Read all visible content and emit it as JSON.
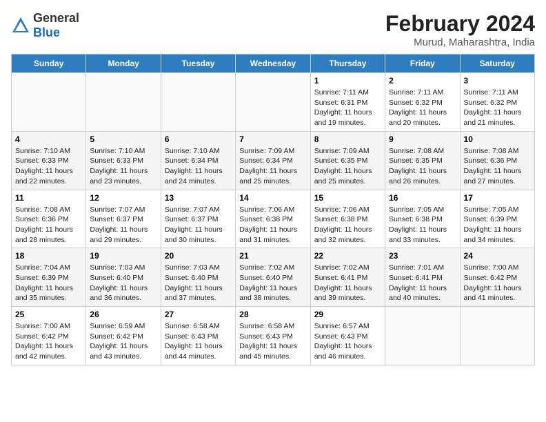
{
  "logo": {
    "text_general": "General",
    "text_blue": "Blue"
  },
  "title": "February 2024",
  "subtitle": "Murud, Maharashtra, India",
  "days_header": [
    "Sunday",
    "Monday",
    "Tuesday",
    "Wednesday",
    "Thursday",
    "Friday",
    "Saturday"
  ],
  "weeks": [
    [
      {
        "day": "",
        "info": ""
      },
      {
        "day": "",
        "info": ""
      },
      {
        "day": "",
        "info": ""
      },
      {
        "day": "",
        "info": ""
      },
      {
        "day": "1",
        "info": "Sunrise: 7:11 AM\nSunset: 6:31 PM\nDaylight: 11 hours\nand 19 minutes."
      },
      {
        "day": "2",
        "info": "Sunrise: 7:11 AM\nSunset: 6:32 PM\nDaylight: 11 hours\nand 20 minutes."
      },
      {
        "day": "3",
        "info": "Sunrise: 7:11 AM\nSunset: 6:32 PM\nDaylight: 11 hours\nand 21 minutes."
      }
    ],
    [
      {
        "day": "4",
        "info": "Sunrise: 7:10 AM\nSunset: 6:33 PM\nDaylight: 11 hours\nand 22 minutes."
      },
      {
        "day": "5",
        "info": "Sunrise: 7:10 AM\nSunset: 6:33 PM\nDaylight: 11 hours\nand 23 minutes."
      },
      {
        "day": "6",
        "info": "Sunrise: 7:10 AM\nSunset: 6:34 PM\nDaylight: 11 hours\nand 24 minutes."
      },
      {
        "day": "7",
        "info": "Sunrise: 7:09 AM\nSunset: 6:34 PM\nDaylight: 11 hours\nand 25 minutes."
      },
      {
        "day": "8",
        "info": "Sunrise: 7:09 AM\nSunset: 6:35 PM\nDaylight: 11 hours\nand 25 minutes."
      },
      {
        "day": "9",
        "info": "Sunrise: 7:08 AM\nSunset: 6:35 PM\nDaylight: 11 hours\nand 26 minutes."
      },
      {
        "day": "10",
        "info": "Sunrise: 7:08 AM\nSunset: 6:36 PM\nDaylight: 11 hours\nand 27 minutes."
      }
    ],
    [
      {
        "day": "11",
        "info": "Sunrise: 7:08 AM\nSunset: 6:36 PM\nDaylight: 11 hours\nand 28 minutes."
      },
      {
        "day": "12",
        "info": "Sunrise: 7:07 AM\nSunset: 6:37 PM\nDaylight: 11 hours\nand 29 minutes."
      },
      {
        "day": "13",
        "info": "Sunrise: 7:07 AM\nSunset: 6:37 PM\nDaylight: 11 hours\nand 30 minutes."
      },
      {
        "day": "14",
        "info": "Sunrise: 7:06 AM\nSunset: 6:38 PM\nDaylight: 11 hours\nand 31 minutes."
      },
      {
        "day": "15",
        "info": "Sunrise: 7:06 AM\nSunset: 6:38 PM\nDaylight: 11 hours\nand 32 minutes."
      },
      {
        "day": "16",
        "info": "Sunrise: 7:05 AM\nSunset: 6:38 PM\nDaylight: 11 hours\nand 33 minutes."
      },
      {
        "day": "17",
        "info": "Sunrise: 7:05 AM\nSunset: 6:39 PM\nDaylight: 11 hours\nand 34 minutes."
      }
    ],
    [
      {
        "day": "18",
        "info": "Sunrise: 7:04 AM\nSunset: 6:39 PM\nDaylight: 11 hours\nand 35 minutes."
      },
      {
        "day": "19",
        "info": "Sunrise: 7:03 AM\nSunset: 6:40 PM\nDaylight: 11 hours\nand 36 minutes."
      },
      {
        "day": "20",
        "info": "Sunrise: 7:03 AM\nSunset: 6:40 PM\nDaylight: 11 hours\nand 37 minutes."
      },
      {
        "day": "21",
        "info": "Sunrise: 7:02 AM\nSunset: 6:40 PM\nDaylight: 11 hours\nand 38 minutes."
      },
      {
        "day": "22",
        "info": "Sunrise: 7:02 AM\nSunset: 6:41 PM\nDaylight: 11 hours\nand 39 minutes."
      },
      {
        "day": "23",
        "info": "Sunrise: 7:01 AM\nSunset: 6:41 PM\nDaylight: 11 hours\nand 40 minutes."
      },
      {
        "day": "24",
        "info": "Sunrise: 7:00 AM\nSunset: 6:42 PM\nDaylight: 11 hours\nand 41 minutes."
      }
    ],
    [
      {
        "day": "25",
        "info": "Sunrise: 7:00 AM\nSunset: 6:42 PM\nDaylight: 11 hours\nand 42 minutes."
      },
      {
        "day": "26",
        "info": "Sunrise: 6:59 AM\nSunset: 6:42 PM\nDaylight: 11 hours\nand 43 minutes."
      },
      {
        "day": "27",
        "info": "Sunrise: 6:58 AM\nSunset: 6:43 PM\nDaylight: 11 hours\nand 44 minutes."
      },
      {
        "day": "28",
        "info": "Sunrise: 6:58 AM\nSunset: 6:43 PM\nDaylight: 11 hours\nand 45 minutes."
      },
      {
        "day": "29",
        "info": "Sunrise: 6:57 AM\nSunset: 6:43 PM\nDaylight: 11 hours\nand 46 minutes."
      },
      {
        "day": "",
        "info": ""
      },
      {
        "day": "",
        "info": ""
      }
    ]
  ]
}
